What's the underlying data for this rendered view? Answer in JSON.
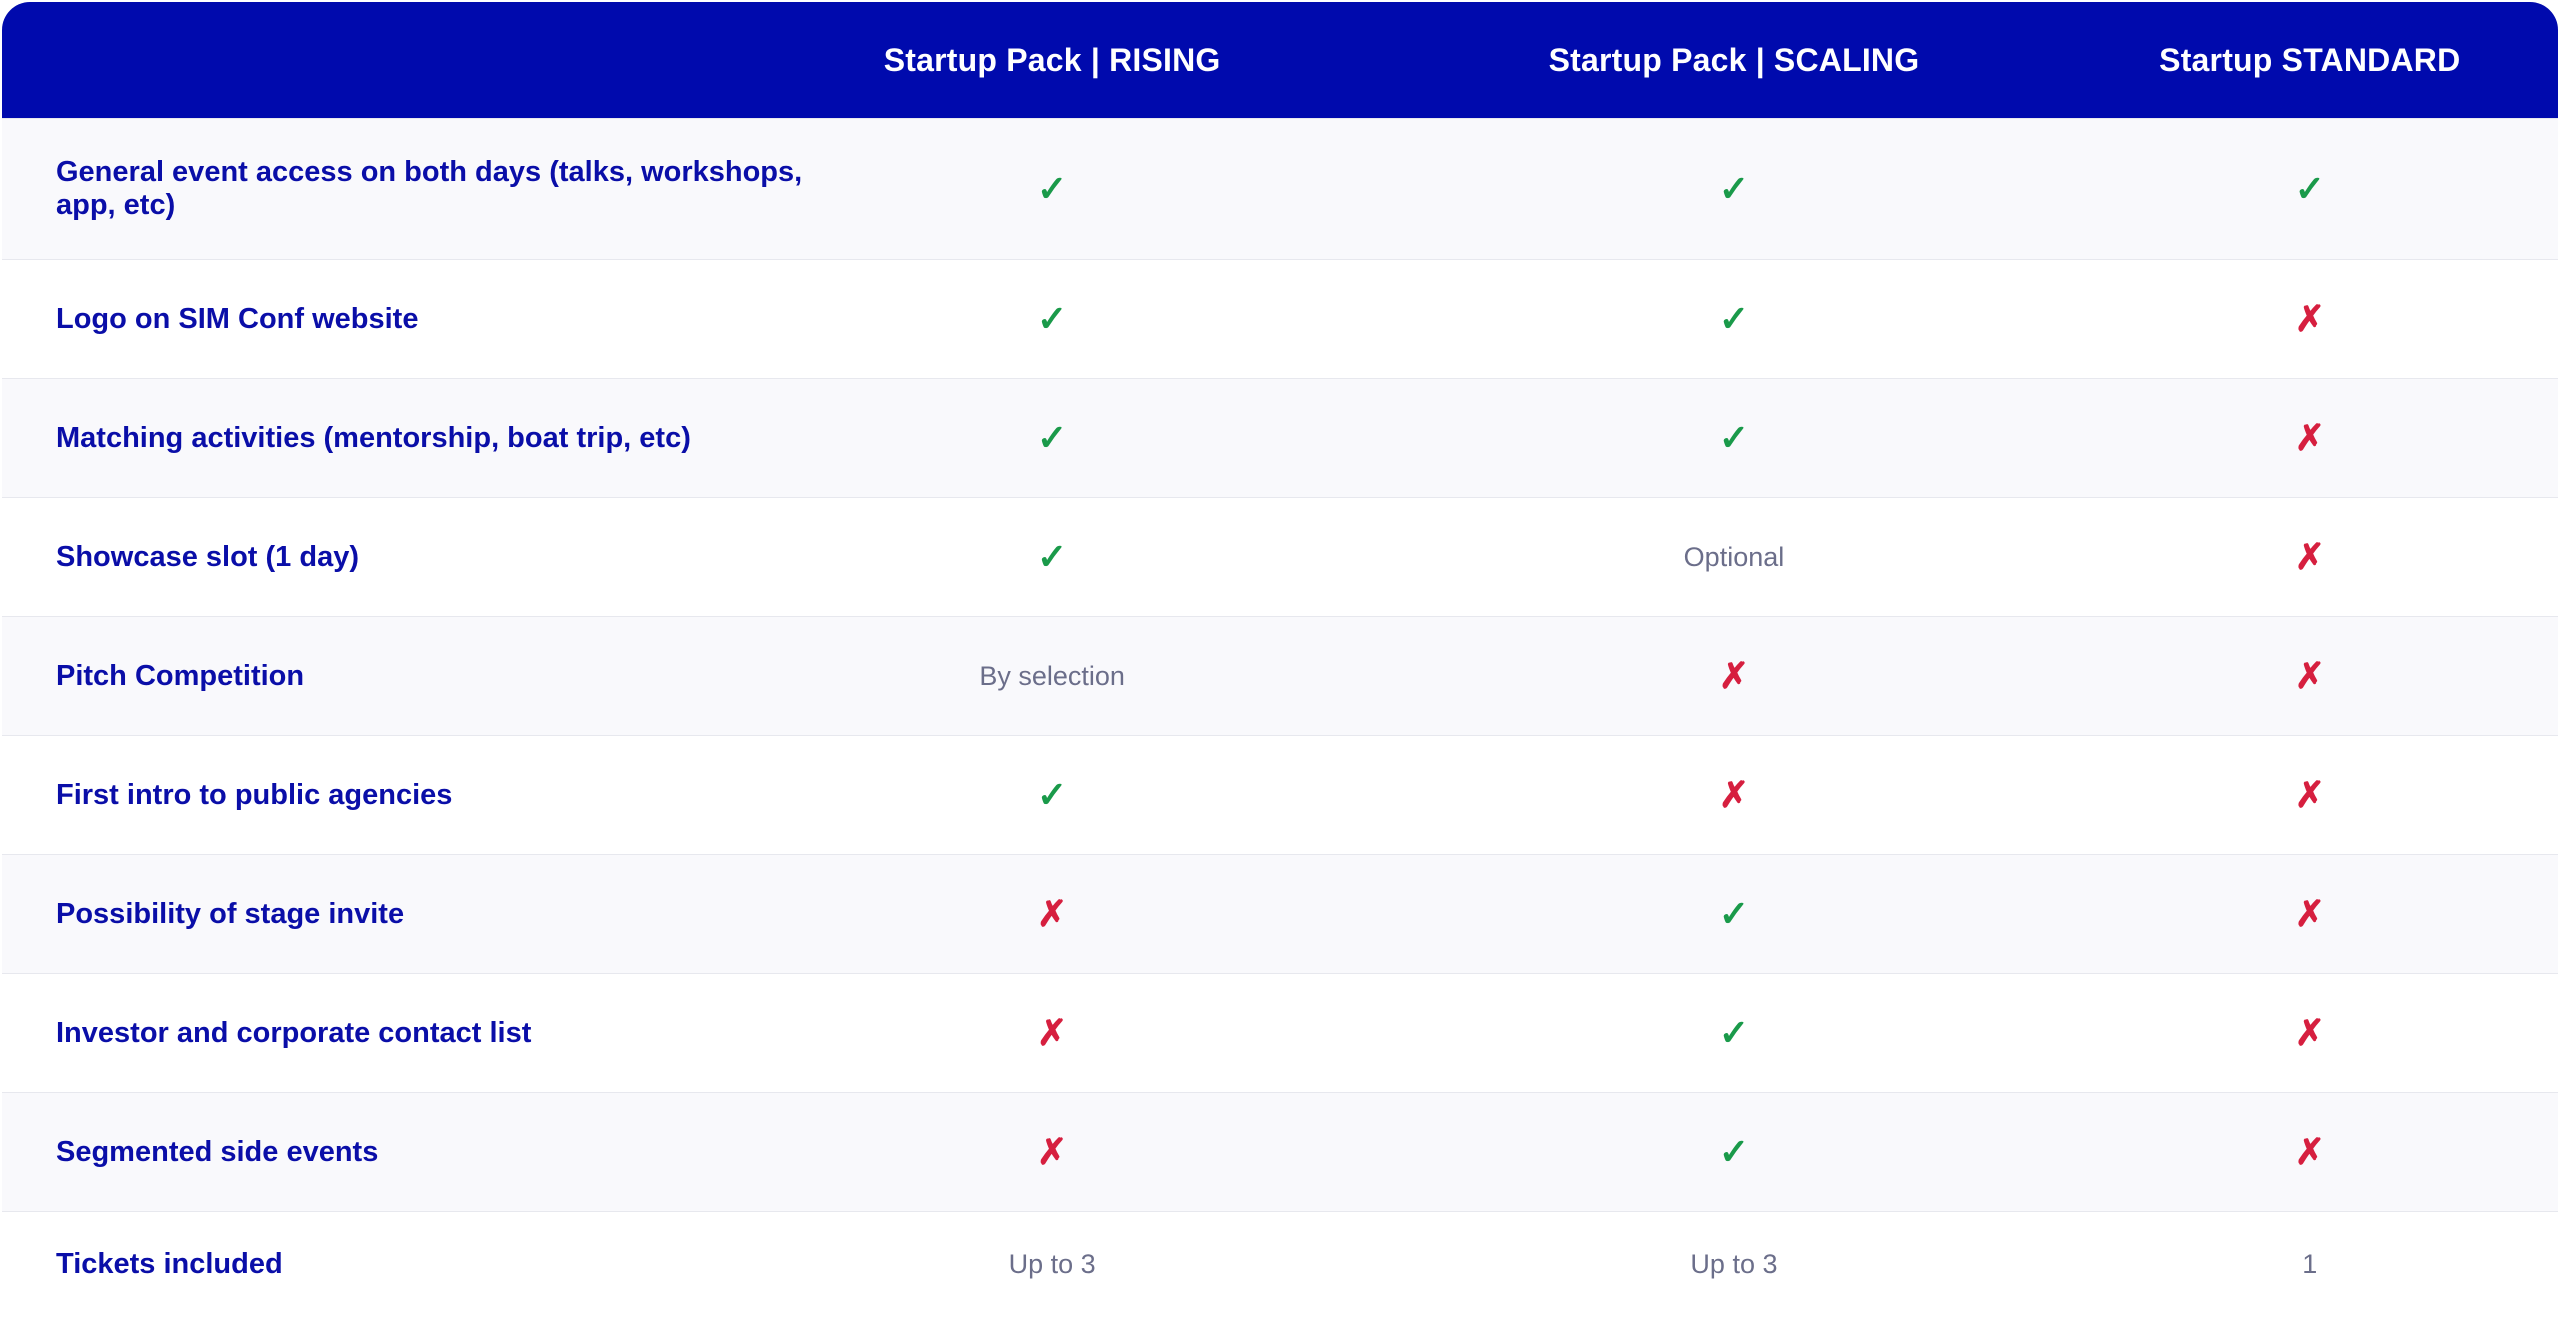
{
  "columns": [
    "Startup Pack | RISING",
    "Startup Pack | SCALING",
    "Startup STANDARD"
  ],
  "symbols": {
    "yes": "✓",
    "no": "✗"
  },
  "colors": {
    "header_bg": "#000aad",
    "feature_text": "#0a0ea8",
    "check": "#1a9a4a",
    "cross": "#d61f3f",
    "value_text": "#6b6e8a"
  },
  "rows": [
    {
      "feature": "General event access on both days (talks, workshops, app, etc)",
      "values": [
        {
          "type": "check",
          "text": "✓"
        },
        {
          "type": "check",
          "text": "✓"
        },
        {
          "type": "check",
          "text": "✓"
        }
      ]
    },
    {
      "feature": "Logo on SIM Conf website",
      "values": [
        {
          "type": "check",
          "text": "✓"
        },
        {
          "type": "check",
          "text": "✓"
        },
        {
          "type": "cross",
          "text": "✗"
        }
      ]
    },
    {
      "feature": "Matching activities (mentorship, boat trip, etc)",
      "values": [
        {
          "type": "check",
          "text": "✓"
        },
        {
          "type": "check",
          "text": "✓"
        },
        {
          "type": "cross",
          "text": "✗"
        }
      ]
    },
    {
      "feature": "Showcase slot (1 day)",
      "values": [
        {
          "type": "check",
          "text": "✓"
        },
        {
          "type": "text",
          "text": "Optional"
        },
        {
          "type": "cross",
          "text": "✗"
        }
      ]
    },
    {
      "feature": "Pitch Competition",
      "values": [
        {
          "type": "text",
          "text": "By selection"
        },
        {
          "type": "cross",
          "text": "✗"
        },
        {
          "type": "cross",
          "text": "✗"
        }
      ]
    },
    {
      "feature": "First intro to public agencies",
      "values": [
        {
          "type": "check",
          "text": "✓"
        },
        {
          "type": "cross",
          "text": "✗"
        },
        {
          "type": "cross",
          "text": "✗"
        }
      ]
    },
    {
      "feature": "Possibility of stage invite",
      "values": [
        {
          "type": "cross",
          "text": "✗"
        },
        {
          "type": "check",
          "text": "✓"
        },
        {
          "type": "cross",
          "text": "✗"
        }
      ]
    },
    {
      "feature": "Investor and corporate contact list",
      "values": [
        {
          "type": "cross",
          "text": "✗"
        },
        {
          "type": "check",
          "text": "✓"
        },
        {
          "type": "cross",
          "text": "✗"
        }
      ]
    },
    {
      "feature": "Segmented side events",
      "values": [
        {
          "type": "cross",
          "text": "✗"
        },
        {
          "type": "check",
          "text": "✓"
        },
        {
          "type": "cross",
          "text": "✗"
        }
      ]
    },
    {
      "feature": "Tickets included",
      "values": [
        {
          "type": "text",
          "text": "Up to 3"
        },
        {
          "type": "text",
          "text": "Up to 3"
        },
        {
          "type": "text",
          "text": "1"
        }
      ]
    }
  ]
}
